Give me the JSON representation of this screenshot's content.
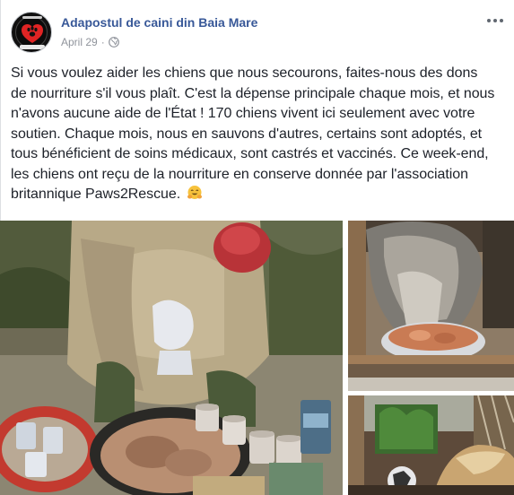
{
  "post": {
    "page_name": "Adapostul de caini din Baia Mare",
    "date": "April 29",
    "separator": "·",
    "avatar": {
      "icon": "paw-logo-icon",
      "colors": {
        "background": "#111111",
        "paw": "#e02424"
      }
    },
    "body_lines": [
      "Si vous voulez aider les chiens que nous secourons, faites-nous des dons",
      "de nourriture s'il vous plaît. C'est la dépense principale chaque mois, et nous",
      "n'avons aucune aide de l'État ! 170 chiens vivent ici seulement avec votre",
      "soutien. Chaque mois, nous en sauvons d'autres, certains sont adoptés, et",
      "tous bénéficient de soins médicaux, sont castrés et vaccinés. Ce week-end,",
      "les chiens ont reçu de la nourriture en conserve donnée par l'association",
      "britannique Paws2Rescue."
    ],
    "emoji": "hugging-face-emoji",
    "photos": [
      {
        "name": "volunteer-opening-canned-food-photo"
      },
      {
        "name": "shaggy-dog-eating-photo"
      },
      {
        "name": "dog-in-yard-photo"
      }
    ]
  },
  "icons": {
    "audience": "globe-icon",
    "menu": "more-options-icon"
  },
  "colors": {
    "link": "#385898",
    "text": "#1d2129",
    "meta": "#90949c"
  }
}
